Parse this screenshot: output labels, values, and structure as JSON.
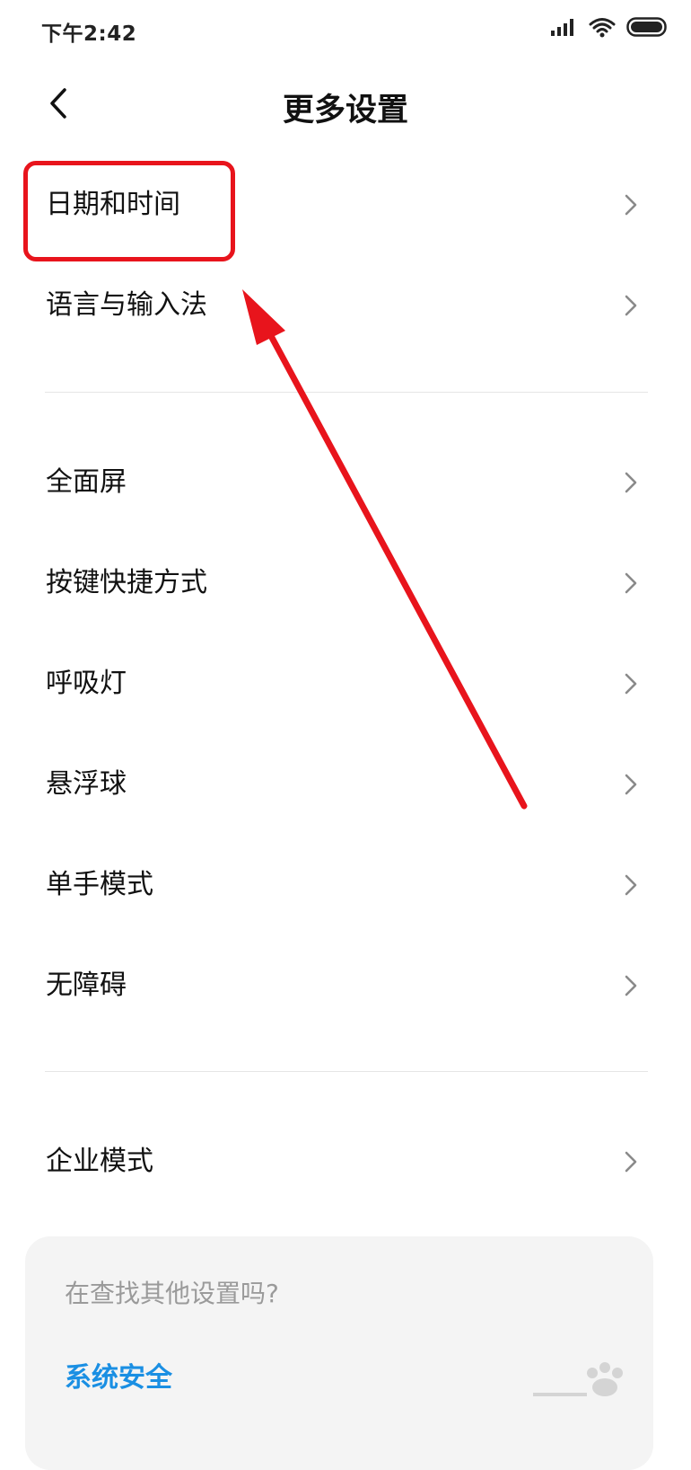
{
  "status_bar": {
    "time": "下午2:42",
    "signal_icon": "signal-icon",
    "wifi_icon": "wifi-icon",
    "battery_icon": "battery-icon"
  },
  "header": {
    "back_icon": "back-arrow-icon",
    "title": "更多设置"
  },
  "settings": {
    "group1": [
      {
        "label": "日期和时间"
      },
      {
        "label": "语言与输入法"
      }
    ],
    "group2": [
      {
        "label": "全面屏"
      },
      {
        "label": "按键快捷方式"
      },
      {
        "label": "呼吸灯"
      },
      {
        "label": "悬浮球"
      },
      {
        "label": "单手模式"
      },
      {
        "label": "无障碍"
      }
    ],
    "group3": [
      {
        "label": "企业模式"
      }
    ]
  },
  "search_card": {
    "prompt": "在查找其他设置吗?",
    "link": "系统安全"
  },
  "annotation": {
    "highlight_color": "#e8141c"
  },
  "colors": {
    "link": "#1a8fe3",
    "chevron": "#8a8a8a"
  }
}
